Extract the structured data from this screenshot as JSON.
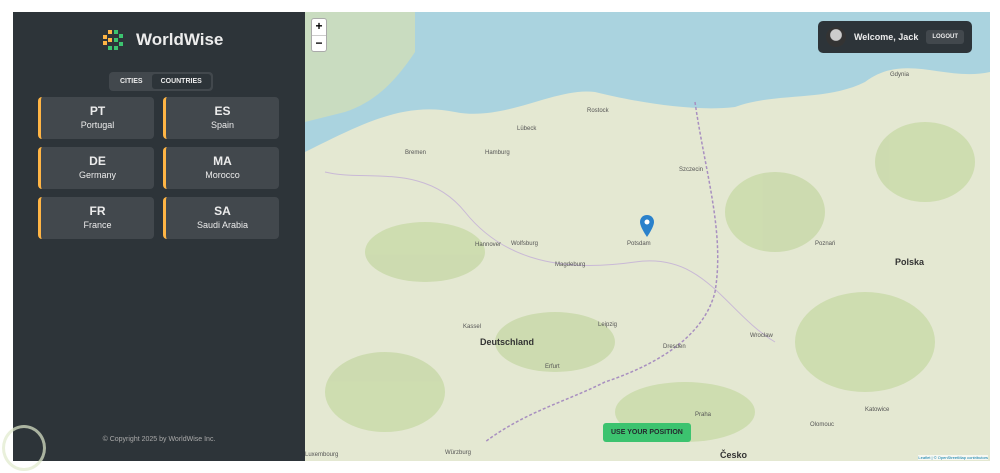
{
  "app": {
    "name": "WorldWise",
    "copyright": "© Copyright 2025 by WorldWise Inc."
  },
  "tabs": [
    {
      "label": "CITIES",
      "active": false
    },
    {
      "label": "COUNTRIES",
      "active": true
    }
  ],
  "countries": [
    {
      "code": "PT",
      "name": "Portugal"
    },
    {
      "code": "ES",
      "name": "Spain"
    },
    {
      "code": "DE",
      "name": "Germany"
    },
    {
      "code": "MA",
      "name": "Morocco"
    },
    {
      "code": "FR",
      "name": "France"
    },
    {
      "code": "SA",
      "name": "Saudi Arabia"
    }
  ],
  "user": {
    "welcome": "Welcome, Jack",
    "logout": "LOGOUT"
  },
  "map": {
    "zoom_in": "+",
    "zoom_out": "−",
    "use_position": "USE YOUR POSITION",
    "attribution": "Leaflet | © OpenStreetMap contributors",
    "labels": [
      {
        "t": "Deutschland",
        "big": true
      },
      {
        "t": "Polska",
        "big": true
      },
      {
        "t": "Česko",
        "big": true
      },
      {
        "t": "Hamburg"
      },
      {
        "t": "Bremen"
      },
      {
        "t": "Hannover"
      },
      {
        "t": "Potsdam"
      },
      {
        "t": "Magdeburg"
      },
      {
        "t": "Leipzig"
      },
      {
        "t": "Dresden"
      },
      {
        "t": "Praha"
      },
      {
        "t": "Kassel"
      },
      {
        "t": "Szczecin"
      },
      {
        "t": "Poznań"
      },
      {
        "t": "Lübeck"
      },
      {
        "t": "Rostock"
      },
      {
        "t": "Wolfsburg"
      },
      {
        "t": "Erfurt"
      },
      {
        "t": "Würzburg"
      },
      {
        "t": "Luxembourg"
      },
      {
        "t": "Wrocław"
      },
      {
        "t": "Olomouc"
      },
      {
        "t": "Gdynia"
      },
      {
        "t": "Katowice"
      }
    ]
  },
  "colors": {
    "accent": "#ffb545",
    "button": "#3cc36f",
    "sidebar": "#2d3439"
  }
}
